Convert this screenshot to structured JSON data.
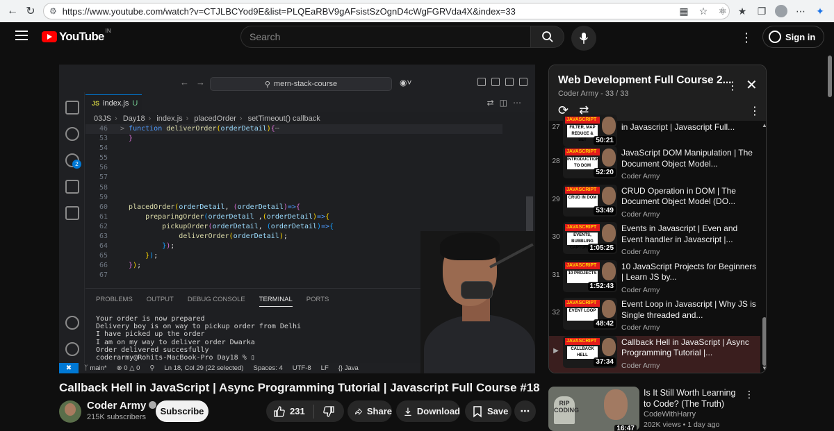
{
  "browser": {
    "url": "https://www.youtube.com/watch?v=CTJLBCYod9E&list=PLQEaRBV9gAFsistSzOgnD4cWgFGRVda4X&index=33"
  },
  "header": {
    "logo_text": "YouTube",
    "region": "IN",
    "search_placeholder": "Search",
    "sign_in": "Sign in"
  },
  "player": {
    "command_center": "mern-stack-course",
    "tab_label": "index.js",
    "tab_status": "U",
    "breadcrumb": [
      "03JS",
      "Day18",
      "index.js",
      "placedOrder",
      "setTimeout() callback"
    ],
    "scm_badge": "2",
    "panel_tabs": [
      "PROBLEMS",
      "OUTPUT",
      "DEBUG CONSOLE",
      "TERMINAL",
      "PORTS"
    ],
    "terminal_lines": [
      "Your order is now prepared",
      "Delivery boy is on way to pickup order from Delhi",
      "I have picked up the order",
      "I am on my way to deliver order Dwarka",
      "Order delivered succesfully",
      "coderarmy@Rohits-MacBook-Pro Day18 % "
    ],
    "status": {
      "branch": "main*",
      "errors": "0",
      "warnings": "0",
      "position": "Ln 18, Col 29 (22 selected)",
      "spaces": "Spaces: 4",
      "encoding": "UTF-8",
      "eol": "LF",
      "language": "Java"
    }
  },
  "video": {
    "title": "Callback Hell in JavaScript | Async Programming Tutorial | Javascript Full Course #18",
    "channel": "Coder Army",
    "subscribers": "215K subscribers",
    "subscribe": "Subscribe",
    "likes": "231",
    "share": "Share",
    "download": "Download",
    "save": "Save"
  },
  "playlist": {
    "title": "Web Development Full Course 2...",
    "subtitle": "Coder Army - 33 / 33",
    "items": [
      {
        "index": "27",
        "title": "in Javascript | Javascript Full...",
        "channel": "",
        "duration": "50:21",
        "topic": "FILTER, MAP REDUCE & SET",
        "active": false
      },
      {
        "index": "28",
        "title": "JavaScript DOM Manipulation | The Document Object Model...",
        "channel": "Coder Army",
        "duration": "52:20",
        "topic": "INTRODUCTION TO DOM",
        "active": false
      },
      {
        "index": "29",
        "title": "CRUD Operation in DOM | The Document Object Model (DO...",
        "channel": "Coder Army",
        "duration": "53:49",
        "topic": "CRUD IN DOM",
        "active": false
      },
      {
        "index": "30",
        "title": "Events in Javascript | Even and Event handler in Javascript |...",
        "channel": "Coder Army",
        "duration": "1:05:25",
        "topic": "EVENTS, BUBBLING CAPTURING",
        "active": false
      },
      {
        "index": "31",
        "title": "10 JavaScript Projects for Beginners | Learn JS by...",
        "channel": "Coder Army",
        "duration": "1:52:43",
        "topic": "10 PROJECTS",
        "active": false
      },
      {
        "index": "32",
        "title": "Event Loop in Javascript | Why JS is Single threaded and...",
        "channel": "Coder Army",
        "duration": "48:42",
        "topic": "EVENT LOOP",
        "active": false
      },
      {
        "index": "▶",
        "title": "Callback Hell in JavaScript | Async Programming Tutorial |...",
        "channel": "Coder Army",
        "duration": "37:34",
        "topic": "CALLBACK HELL",
        "active": true
      }
    ]
  },
  "related": {
    "title": "Is It Still Worth Learning to Code? (The Truth)",
    "channel": "CodeWithHarry",
    "meta": "202K views • 1 day ago",
    "duration": "16:47",
    "thumb_text": "RIP CODING"
  }
}
